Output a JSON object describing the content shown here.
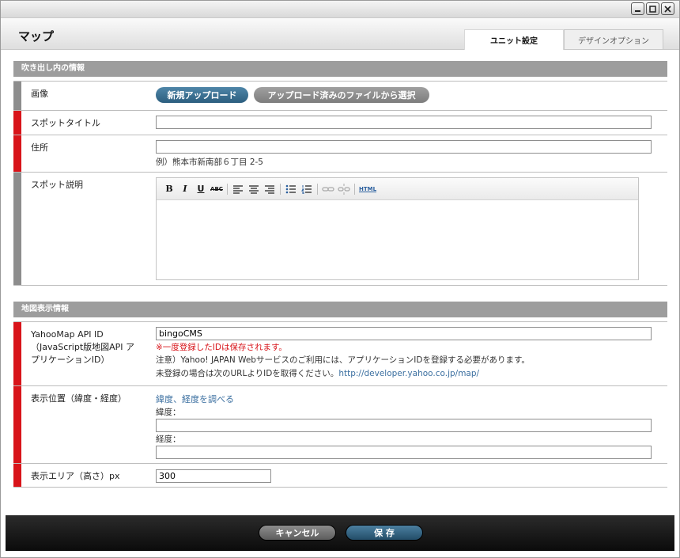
{
  "header": {
    "title": "マップ",
    "tabs": [
      {
        "label": "ユニット設定"
      },
      {
        "label": "デザインオプション"
      }
    ]
  },
  "section1": {
    "title": "吹き出し内の情報",
    "image": {
      "label": "画像",
      "upload_label": "新規アップロード",
      "select_label": "アップロード済みのファイルから選択"
    },
    "spot_title": {
      "label": "スポットタイトル",
      "value": ""
    },
    "address": {
      "label": "住所",
      "value": "",
      "example": "例）熊本市新南部６丁目 2-5"
    },
    "spot_desc": {
      "label": "スポット説明"
    }
  },
  "section2": {
    "title": "地図表示情報",
    "api": {
      "label_line1": "YahooMap API ID",
      "label_line2": "（JavaScript版地図API ア",
      "label_line3": "プリケーションID）",
      "value": "bingoCMS",
      "warning": "※一度登録したIDは保存されます。",
      "note1": "注意）Yahoo! JAPAN Webサービスのご利用には、アプリケーションIDを登録する必要があります。",
      "note2": "未登録の場合は次のURLよりIDを取得ください。",
      "url": "http://developer.yahoo.co.jp/map/"
    },
    "position": {
      "label": "表示位置（緯度・経度）",
      "lookup_link": "緯度、経度を調べる",
      "lat_label": "緯度：",
      "lat_value": "",
      "lng_label": "経度：",
      "lng_value": ""
    },
    "area": {
      "label": "表示エリア（高さ）px",
      "value": "300"
    }
  },
  "footer": {
    "cancel_label": "キャンセル",
    "save_label": "保 存"
  },
  "toolbar": {
    "bold": "B",
    "italic": "I",
    "underline": "U",
    "strike": "ABC",
    "html": "HTML"
  },
  "colors": {
    "accent_blue": "#2c5e7f",
    "required_red": "#d8141a",
    "section_gray": "#9d9d9d"
  }
}
